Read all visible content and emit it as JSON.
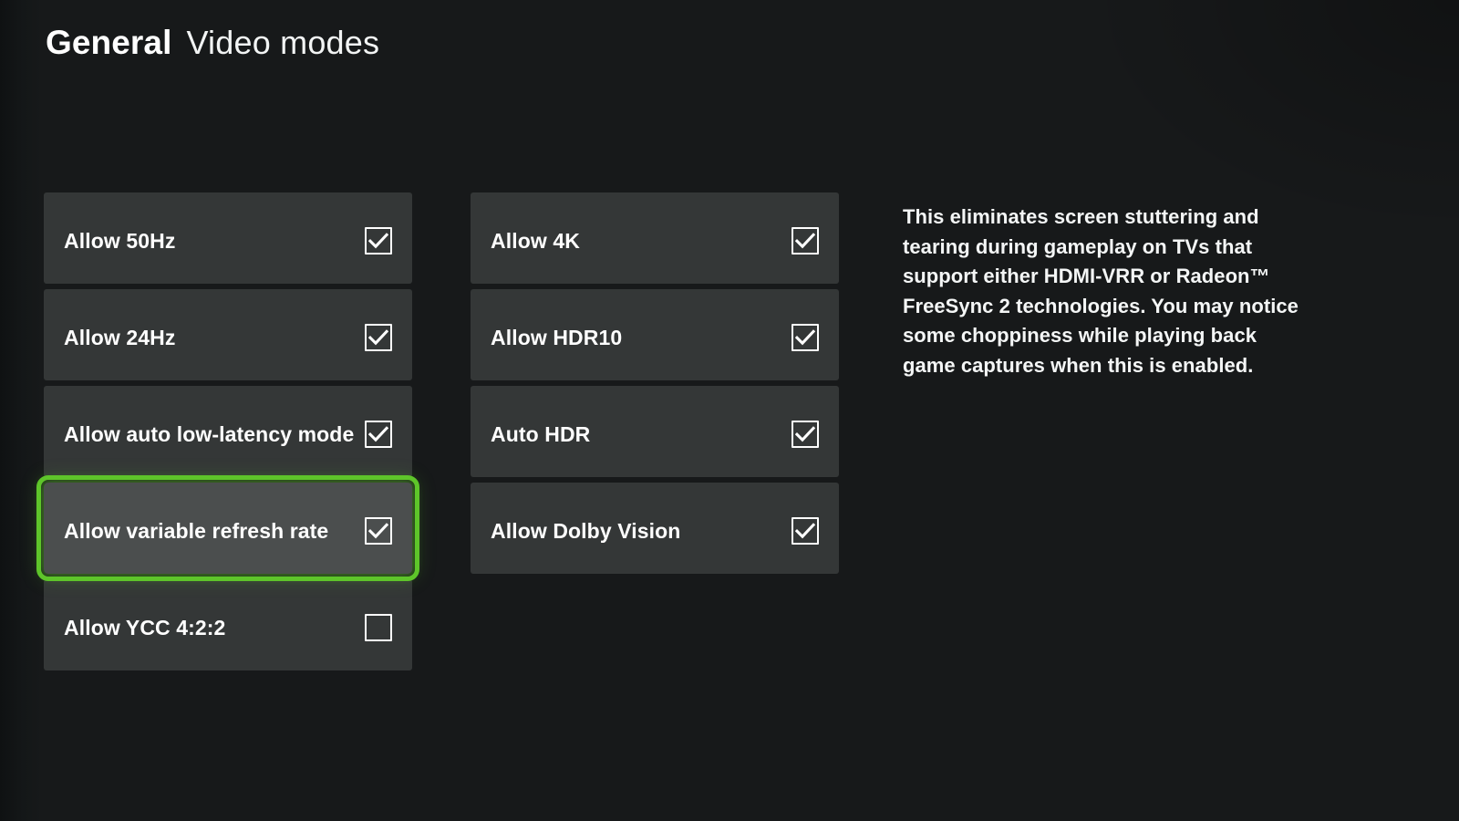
{
  "header": {
    "primary": "General",
    "secondary": "Video modes"
  },
  "accent_color": "#5ec52a",
  "row_color": "#343737",
  "row_focused_color": "#4b4e4e",
  "background_color": "#17191a",
  "columns": [
    {
      "name": "left",
      "items": [
        {
          "label": "Allow 50Hz",
          "checked": true,
          "focused": false
        },
        {
          "label": "Allow 24Hz",
          "checked": true,
          "focused": false
        },
        {
          "label": "Allow auto low-latency mode",
          "checked": true,
          "focused": false
        },
        {
          "label": "Allow variable refresh rate",
          "checked": true,
          "focused": true
        },
        {
          "label": "Allow YCC 4:2:2",
          "checked": false,
          "focused": false
        }
      ]
    },
    {
      "name": "right",
      "items": [
        {
          "label": "Allow 4K",
          "checked": true,
          "focused": false
        },
        {
          "label": "Allow HDR10",
          "checked": true,
          "focused": false
        },
        {
          "label": "Auto HDR",
          "checked": true,
          "focused": false
        },
        {
          "label": "Allow Dolby Vision",
          "checked": true,
          "focused": false
        }
      ]
    }
  ],
  "description": {
    "text": "This eliminates screen stuttering and tearing during gameplay on TVs that support either HDMI-VRR or Radeon™ FreeSync 2 technologies. You may notice some choppiness while playing back game captures when this is enabled."
  }
}
